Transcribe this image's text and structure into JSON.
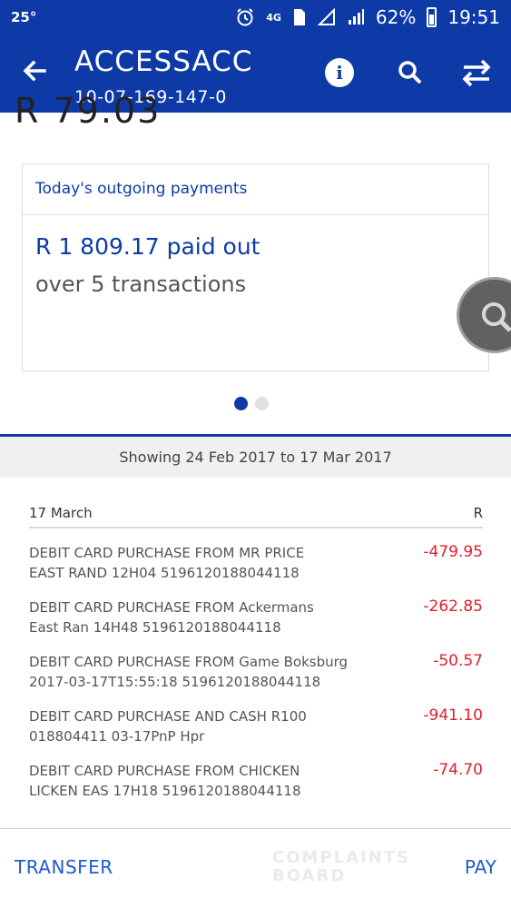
{
  "status_bar": {
    "temperature": "25°",
    "network": "4G",
    "battery": "62%",
    "time": "19:51"
  },
  "header": {
    "account_name": "ACCESSACC",
    "account_number": "10-07-169-147-0",
    "info_icon_label": "i"
  },
  "balance": {
    "partial_text": "R 79.03"
  },
  "summary_card": {
    "title": "Today's outgoing payments",
    "amount_text": "R 1 809.17 paid out",
    "count_text": "over 5 transactions"
  },
  "pager": {
    "pages": 2,
    "active": 1
  },
  "date_range": "Showing 24 Feb 2017 to 17 Mar 2017",
  "transactions": {
    "date": "17 March",
    "currency": "R",
    "items": [
      {
        "line1": "DEBIT CARD PURCHASE FROM MR PRICE",
        "line2": "EAST RAND 12H04 5196120188044118",
        "amount": "-479.95"
      },
      {
        "line1": "DEBIT CARD PURCHASE FROM Ackermans",
        "line2": "East Ran 14H48 5196120188044118",
        "amount": "-262.85"
      },
      {
        "line1": "DEBIT CARD PURCHASE FROM Game Boksburg",
        "line2": "2017-03-17T15:55:18 5196120188044118",
        "amount": "-50.57"
      },
      {
        "line1": "DEBIT CARD PURCHASE AND CASH R100",
        "line2": "018804411 03-17PnP Hpr",
        "amount": "-941.10"
      },
      {
        "line1": "DEBIT CARD PURCHASE FROM CHICKEN",
        "line2": "LICKEN EAS 17H18 5196120188044118",
        "amount": "-74.70"
      }
    ]
  },
  "bottom_bar": {
    "transfer_label": "TRANSFER",
    "pay_label": "PAY",
    "watermark_line1": "COMPLAINTS",
    "watermark_line2": "BOARD"
  },
  "colors": {
    "primary": "#0e3aa8",
    "negative_amount": "#e11d2a",
    "action_text": "#1e5bd6"
  }
}
